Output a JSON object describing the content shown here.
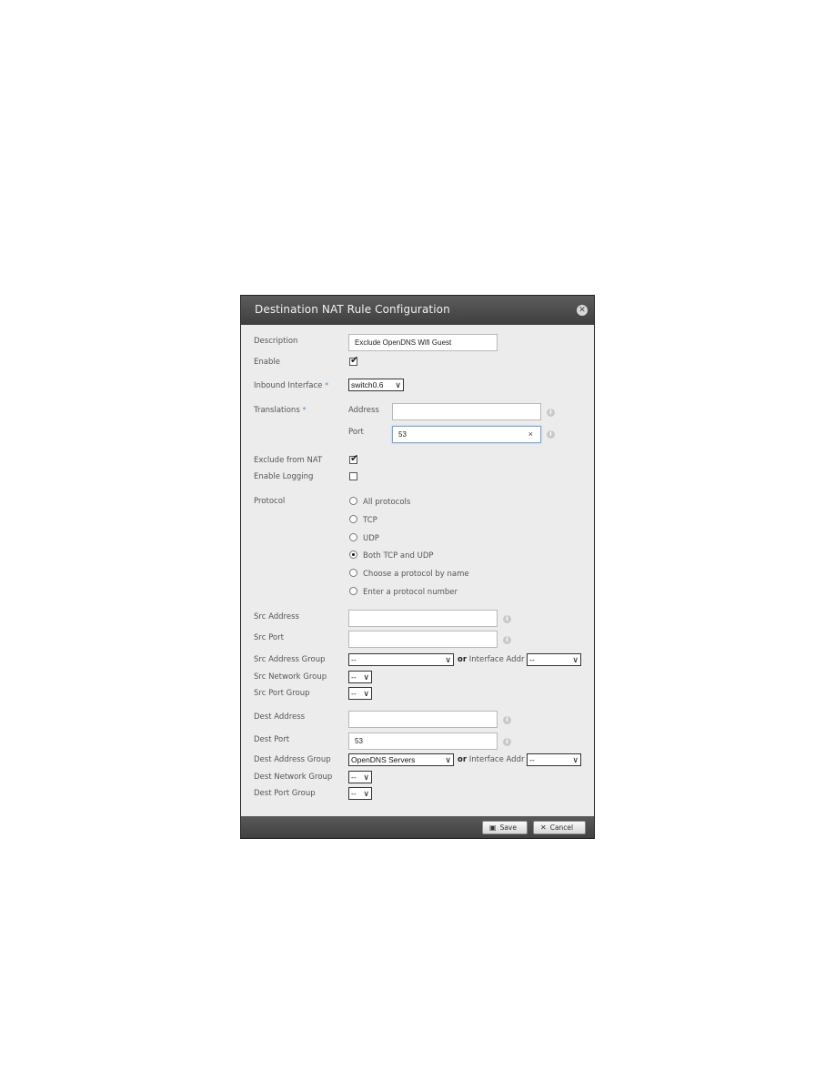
{
  "dialog": {
    "title": "Destination NAT Rule Configuration",
    "close_icon": "close-icon"
  },
  "form": {
    "description": {
      "label": "Description",
      "value": "Exclude OpenDNS Wifi Guest"
    },
    "enable": {
      "label": "Enable",
      "checked": true
    },
    "inbound_interface": {
      "label": "Inbound Interface",
      "required_mark": "*",
      "value": "switch0.6"
    },
    "translations": {
      "label": "Translations",
      "required_mark": "*",
      "address_label": "Address",
      "address_value": "",
      "port_label": "Port",
      "port_value": "53",
      "clear_glyph": "×"
    },
    "exclude_from_nat": {
      "label": "Exclude from NAT",
      "checked": true
    },
    "enable_logging": {
      "label": "Enable Logging",
      "checked": false
    },
    "protocol": {
      "label": "Protocol",
      "options": [
        "All protocols",
        "TCP",
        "UDP",
        "Both TCP and UDP",
        "Choose a protocol by name",
        "Enter a protocol number"
      ],
      "selected": "Both TCP and UDP"
    },
    "src_address": {
      "label": "Src Address",
      "value": ""
    },
    "src_port": {
      "label": "Src Port",
      "value": ""
    },
    "src_address_group": {
      "label": "Src Address Group",
      "value": "--",
      "or_text": "or",
      "iface_label": "Interface Addr",
      "iface_value": "--"
    },
    "src_network_group": {
      "label": "Src Network Group",
      "value": "--"
    },
    "src_port_group": {
      "label": "Src Port Group",
      "value": "--"
    },
    "dest_address": {
      "label": "Dest Address",
      "value": ""
    },
    "dest_port": {
      "label": "Dest Port",
      "value": "53"
    },
    "dest_address_group": {
      "label": "Dest Address Group",
      "value": "OpenDNS Servers",
      "or_text": "or",
      "iface_label": "Interface Addr",
      "iface_value": "--"
    },
    "dest_network_group": {
      "label": "Dest Network Group",
      "value": "--"
    },
    "dest_port_group": {
      "label": "Dest Port Group",
      "value": "--"
    }
  },
  "footer": {
    "save_label": "Save",
    "cancel_label": "Cancel"
  },
  "glyphs": {
    "check": "✔",
    "info": "i",
    "chevron": "⌄",
    "close": "✕"
  }
}
